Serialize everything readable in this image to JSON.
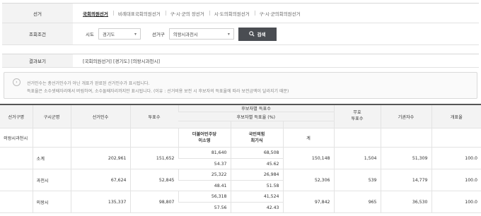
{
  "search": {
    "election_label": "선거",
    "tabs": [
      "국회의원선거",
      "비례대표국회의원선거",
      "구·시·군의 장선거",
      "시·도의회의원선거",
      "구·시·군의회의원선거"
    ],
    "condition_label": "조회조건",
    "sido_label": "시도",
    "sido_value": "경기도",
    "gu_label": "선거구",
    "gu_value": "의왕시과천시",
    "search_button": "검색"
  },
  "result": {
    "label": "결과보기",
    "path": "[국회의원선거] [경기도] [의왕시과천시]"
  },
  "notice": {
    "line1": "선거인수는 총선거인수가 아닌 개표가 완료된 선거인수가 표시됩니다.",
    "line2": "득표율은 소수셋째자리에서 버림하여, 소수둘째자리까지만 표시됩니다. (이유 : 선거비용 보전 시 후보자의 득표율에 따라 보전금액이 달라지기 때문)"
  },
  "table": {
    "headers": {
      "district": "선거구명",
      "area": "구시군명",
      "voters": "선거인수",
      "votes": "투표수",
      "candidate_votes": "후보자별 득표수",
      "candidate_rate": "후보자별 득표율 (%)",
      "invalid": "무효\n투표수",
      "abstain": "기권자수",
      "turnout": "개표율",
      "total": "계"
    },
    "candidates": [
      {
        "party": "더불어민주당",
        "name": "이소영"
      },
      {
        "party": "국민의힘",
        "name": "최기식"
      }
    ],
    "district_name": "의왕시과천시",
    "rows": [
      {
        "area": "소계",
        "voters": "202,961",
        "votes": "151,652",
        "cand1": "81,640",
        "cand2": "68,508",
        "total": "150,148",
        "invalid": "1,504",
        "abstain": "51,309",
        "turnout": "100.0",
        "rate1": "54.37",
        "rate2": "45.62"
      },
      {
        "area": "과천시",
        "voters": "67,624",
        "votes": "52,845",
        "cand1": "25,322",
        "cand2": "26,984",
        "total": "52,306",
        "invalid": "539",
        "abstain": "14,779",
        "turnout": "100.0",
        "rate1": "48.41",
        "rate2": "51.58"
      },
      {
        "area": "의왕시",
        "voters": "135,337",
        "votes": "98,807",
        "cand1": "56,318",
        "cand2": "41,524",
        "total": "97,842",
        "invalid": "965",
        "abstain": "36,530",
        "turnout": "100.0",
        "rate1": "57.56",
        "rate2": "42.43"
      }
    ]
  }
}
